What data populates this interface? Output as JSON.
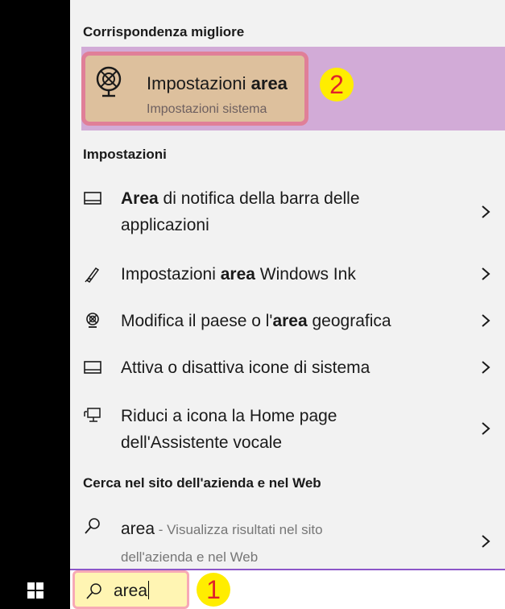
{
  "headers": {
    "best_match": "Corrispondenza migliore",
    "settings": "Impostazioni",
    "web": "Cerca nel sito dell'azienda e nel Web"
  },
  "best_match": {
    "title_normal": "Impostazioni",
    "title_bold": "area",
    "subtitle": "Impostazioni sistema",
    "icon": "globe-settings-icon"
  },
  "settings_items": [
    {
      "icon": "taskbar-icon",
      "bold": "Area",
      "line1_rest": " di notifica della barra delle",
      "line2": "applicazioni"
    },
    {
      "icon": "pen-icon",
      "pre": "Impostazioni ",
      "bold": "area",
      "post": " Windows Ink"
    },
    {
      "icon": "globe-icon",
      "pre": "Modifica il paese o l'",
      "bold": "area",
      "post": " geografica"
    },
    {
      "icon": "taskbar-icon",
      "text": "Attiva o disattiva icone di sistema"
    },
    {
      "icon": "narrator-icon",
      "line1": "Riduci a icona la Home page",
      "line2": "dell'Assistente vocale"
    }
  ],
  "web_result": {
    "term": "area",
    "desc_line1": " - Visualizza risultati nel sito",
    "desc_line2": "dell'azienda e nel Web"
  },
  "search": {
    "query": "area"
  },
  "annotations": {
    "step1": "1",
    "step2": "2"
  },
  "colors": {
    "highlight_row": "#d2abd7",
    "highlight_box": "#ddc09d",
    "badge_bg": "#ffed00",
    "badge_text": "#e0232a"
  }
}
